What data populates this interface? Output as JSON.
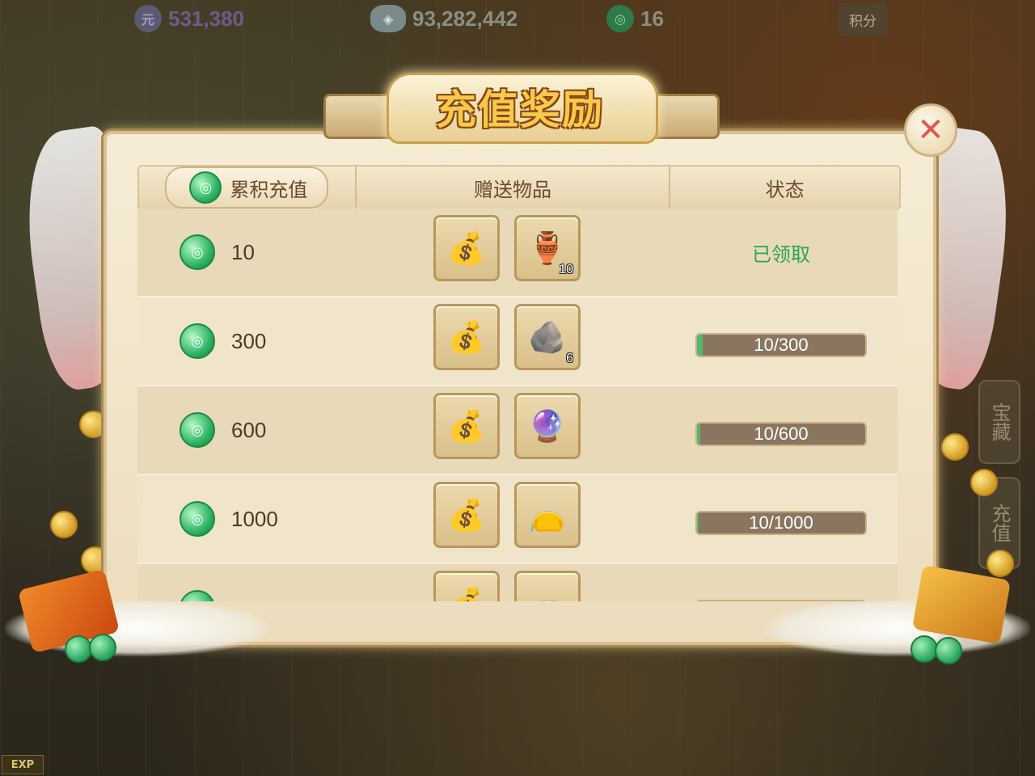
{
  "topbar": {
    "currency1": {
      "icon": "ingot-icon",
      "value": "531,380"
    },
    "currency2": {
      "icon": "silver-icon",
      "value": "93,282,442"
    },
    "currency3": {
      "icon": "jade-icon",
      "value": "16"
    },
    "score_label": "积分"
  },
  "side_tabs": [
    "宝藏",
    "充值"
  ],
  "exp_label": "EXP",
  "dialog": {
    "title": "充值奖励",
    "close_icon": "close-icon",
    "columns": {
      "amount": "累积充值",
      "rewards": "赠送物品",
      "status": "状态"
    },
    "rows": [
      {
        "amount": "10",
        "items": [
          {
            "icon": "ingot-bag-icon",
            "glyph": "💰",
            "qty": ""
          },
          {
            "icon": "vase-plant-icon",
            "glyph": "🏺",
            "qty": "10"
          }
        ],
        "status_text": "已领取",
        "progress": null
      },
      {
        "amount": "300",
        "items": [
          {
            "icon": "ingot-bag-icon",
            "glyph": "💰",
            "qty": ""
          },
          {
            "icon": "ore-stone-icon",
            "glyph": "🪨",
            "qty": "6"
          }
        ],
        "status_text": "10/300",
        "progress": 0.033
      },
      {
        "amount": "600",
        "items": [
          {
            "icon": "ingot-bag-icon",
            "glyph": "💰",
            "qty": ""
          },
          {
            "icon": "crystal-orb-icon",
            "glyph": "🔮",
            "qty": ""
          }
        ],
        "status_text": "10/600",
        "progress": 0.017
      },
      {
        "amount": "1000",
        "items": [
          {
            "icon": "ingot-bag-icon",
            "glyph": "💰",
            "qty": ""
          },
          {
            "icon": "gift-bag-icon",
            "glyph": "👝",
            "qty": ""
          }
        ],
        "status_text": "10/1000",
        "progress": 0.01
      },
      {
        "amount": "",
        "items": [
          {
            "icon": "ingot-bag-icon",
            "glyph": "💰",
            "qty": ""
          },
          {
            "icon": "gift-bag-icon",
            "glyph": "👝",
            "qty": ""
          }
        ],
        "status_text": "",
        "progress": 0.0
      }
    ]
  },
  "colors": {
    "claimed_green": "#2aa64f",
    "title_gold": "#f8c94a",
    "close_red": "#e2584a"
  }
}
